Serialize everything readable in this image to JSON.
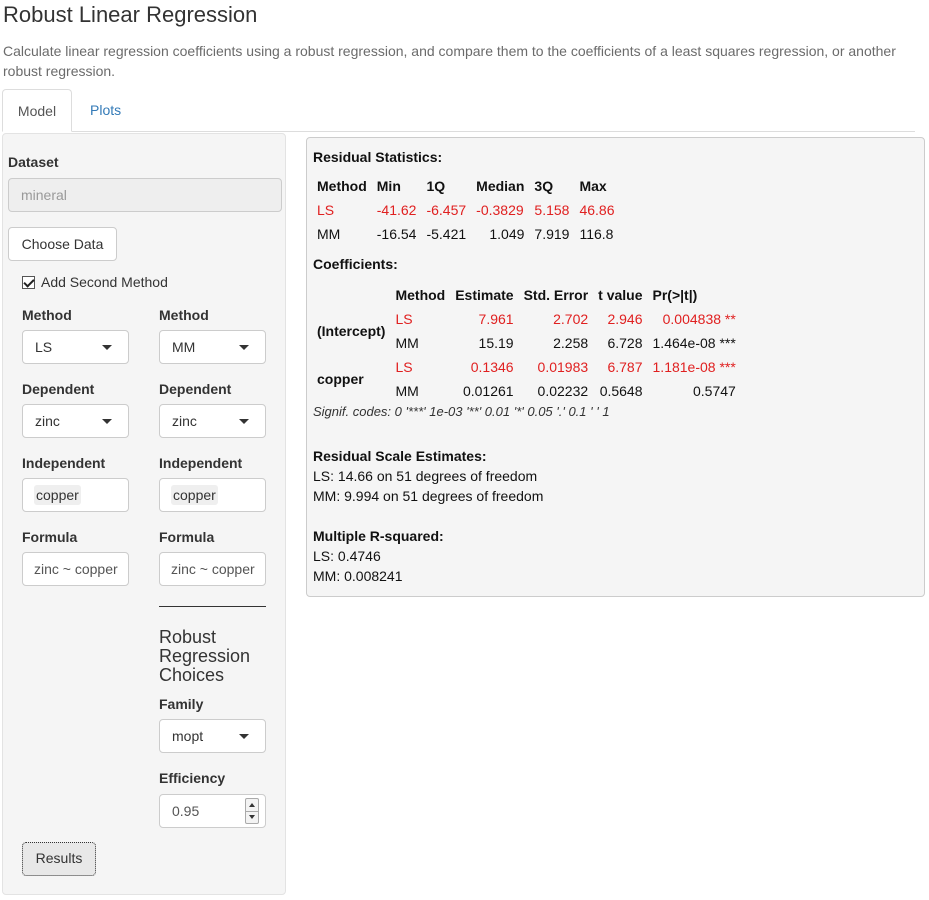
{
  "app": {
    "title": "Robust Linear Regression",
    "description": "Calculate linear regression coefficients using a robust regression, and compare them to the coefficients of a least squares regression, or another robust regression."
  },
  "tabs": [
    {
      "label": "Model",
      "active": true
    },
    {
      "label": "Plots",
      "active": false
    }
  ],
  "sidebar": {
    "dataset_label": "Dataset",
    "dataset_value": "mineral",
    "choose_data_label": "Choose Data",
    "add_second_method_label": "Add Second Method",
    "add_second_method_checked": true,
    "left": {
      "method_label": "Method",
      "method_value": "LS",
      "dependent_label": "Dependent",
      "dependent_value": "zinc",
      "independent_label": "Independent",
      "independent_value": "copper",
      "formula_label": "Formula",
      "formula_value": "zinc ~ copper"
    },
    "right": {
      "method_label": "Method",
      "method_value": "MM",
      "dependent_label": "Dependent",
      "dependent_value": "zinc",
      "independent_label": "Independent",
      "independent_value": "copper",
      "formula_label": "Formula",
      "formula_value": "zinc ~ copper"
    },
    "robust_choices_heading": "Robust Regression Choices",
    "family_label": "Family",
    "family_value": "mopt",
    "efficiency_label": "Efficiency",
    "efficiency_value": "0.95",
    "results_label": "Results"
  },
  "output": {
    "residual_stats_heading": "Residual Statistics:",
    "residual_columns": [
      "Method",
      "Min",
      "1Q",
      "Median",
      "3Q",
      "Max"
    ],
    "residual_rows": [
      {
        "method": "LS",
        "min": "-41.62",
        "q1": "-6.457",
        "median": "-0.3829",
        "q3": "5.158",
        "max": "46.86",
        "highlight": true
      },
      {
        "method": "MM",
        "min": "-16.54",
        "q1": "-5.421",
        "median": "1.049",
        "q3": "7.919",
        "max": "116.8",
        "highlight": false
      }
    ],
    "coefficients_heading": "Coefficients:",
    "coef_columns": [
      "Method",
      "Estimate",
      "Std. Error",
      "t value",
      "Pr(>|t|)"
    ],
    "coef_groups": [
      {
        "term": "(Intercept)",
        "rows": [
          {
            "method": "LS",
            "estimate": "7.961",
            "se": "2.702",
            "t": "2.946",
            "p": "0.004838 **",
            "highlight": true
          },
          {
            "method": "MM",
            "estimate": "15.19",
            "se": "2.258",
            "t": "6.728",
            "p": "1.464e-08 ***",
            "highlight": false
          }
        ]
      },
      {
        "term": "copper",
        "rows": [
          {
            "method": "LS",
            "estimate": "0.1346",
            "se": "0.01983",
            "t": "6.787",
            "p": "1.181e-08 ***",
            "highlight": true
          },
          {
            "method": "MM",
            "estimate": "0.01261",
            "se": "0.02232",
            "t": "0.5648",
            "p": "0.5747",
            "highlight": false
          }
        ]
      }
    ],
    "signif_codes": "Signif. codes: 0 '***' 1e-03 '**' 0.01 '*' 0.05 '.' 0.1 ' ' 1",
    "scale_heading": "Residual Scale Estimates:",
    "scale_ls": "LS: 14.66 on 51 degrees of freedom",
    "scale_mm": "MM: 9.994 on 51 degrees of freedom",
    "rsq_heading": "Multiple R-squared:",
    "rsq_ls": "LS: 0.4746",
    "rsq_mm": "MM: 0.008241"
  },
  "colors": {
    "highlight": "#e02020",
    "link": "#337ab7",
    "panel_bg": "#f5f5f5"
  }
}
